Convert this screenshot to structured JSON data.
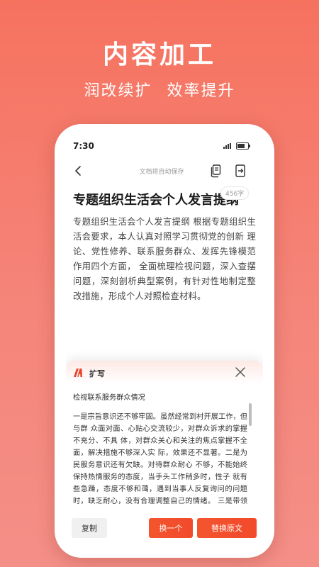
{
  "hero": {
    "title": "内容加工",
    "subtitle_left": "润改续扩",
    "subtitle_right": "效率提升"
  },
  "status_bar": {
    "time": "7:30"
  },
  "app_bar": {
    "autosave_text": "文档将自动保存",
    "icons": [
      "back-arrow-icon",
      "copy-icon",
      "export-icon"
    ]
  },
  "document": {
    "word_count": "456字",
    "title": "专题组织生活会个人发言提纲",
    "body": "专题组织生活会个人发言提纲 根据专题组织生活会要求，本人认真对照学习贯彻党的创新 理论、党性修养、联系服务群众、发挥先锋模范作用四个方面， 全面梳理检视问题，深入查摆问题，深刻剖析典型案例，有针对性地制定整改措施，形成个人对照检查材料。"
  },
  "expand_panel": {
    "title": "扩写",
    "heading": "检视联系服务群众情况",
    "paragraphs": [
      "一是宗旨意识还不够牢固。虽然经常到村开展工作，但与群 众面对面、心贴心交流较少，对群众诉求的掌握不充分、不具 体，对群众关心和关注的焦点掌握不全面，解决措施不够深入实 际，效果还不显著。二是为民服务意识还有欠缺。对待群众耐心 不够，不能始终保持热情服务的态度，当手头工作稍多时，性子 就有些急躁，态度不够和蔼，遇到当事人反复询问的问题时，缺乏耐心，没有合理调整自己的情绪。 三是带领群众发展路子不多。发展能力缺乏，不知道怎样帮 助群众发展致富，总感觉发展没方法，没路子，没资金，没人才，解决不退，工作推进难。"
    ],
    "scroll_fraction": 0.0,
    "buttons": {
      "copy": "复制",
      "swap": "换一个",
      "replace": "替换原文"
    }
  },
  "colors": {
    "background_top": "#f6725f",
    "accent": "#f24a2c",
    "logo": "#e8452c"
  }
}
